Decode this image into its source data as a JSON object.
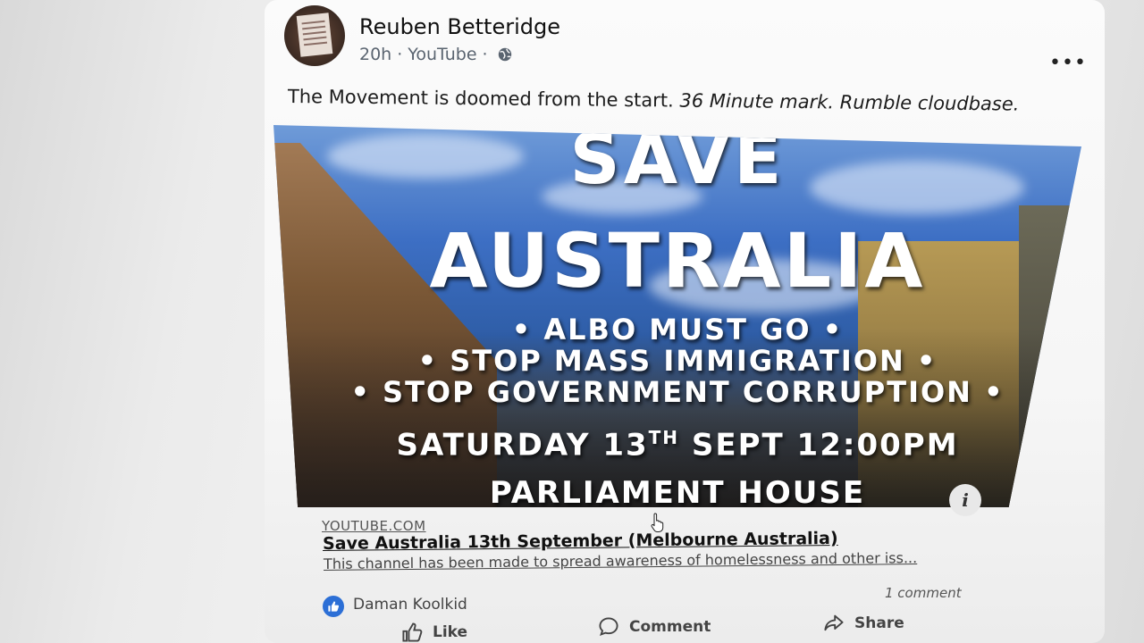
{
  "post": {
    "author": "Reuben Betteridge",
    "time": "20h",
    "separator": "·",
    "source": "YouTube",
    "privacy_icon": "globe-icon",
    "text_plain": "The Movement is doomed from the start.",
    "text_italic": "36 Minute mark. Rumble cloudbase."
  },
  "media": {
    "line_save": "SAVE",
    "line_australia": "AUSTRALIA",
    "line_1": "• ALBO MUST GO •",
    "line_2": "• STOP MASS IMMIGRATION •",
    "line_3": "• STOP GOVERNMENT CORRUPTION •",
    "date_main": "SATURDAY 13",
    "date_sup": "TH",
    "date_rest": " SEPT 12:00PM",
    "place": "PARLIAMENT HOUSE",
    "info_label": "i"
  },
  "link": {
    "domain": "YOUTUBE.COM",
    "title": "Save Australia 13th September (Melbourne Australia)",
    "description": "This channel has been made to spread awareness of homelessness and other iss..."
  },
  "reactions": {
    "reactor": "Daman Koolkid",
    "comments": "1 comment"
  },
  "actions": {
    "like": "Like",
    "comment": "Comment",
    "share": "Share"
  },
  "colors": {
    "reaction_blue": "#2c6fd6",
    "text": "#1c1c1c",
    "meta": "#5a6470"
  }
}
